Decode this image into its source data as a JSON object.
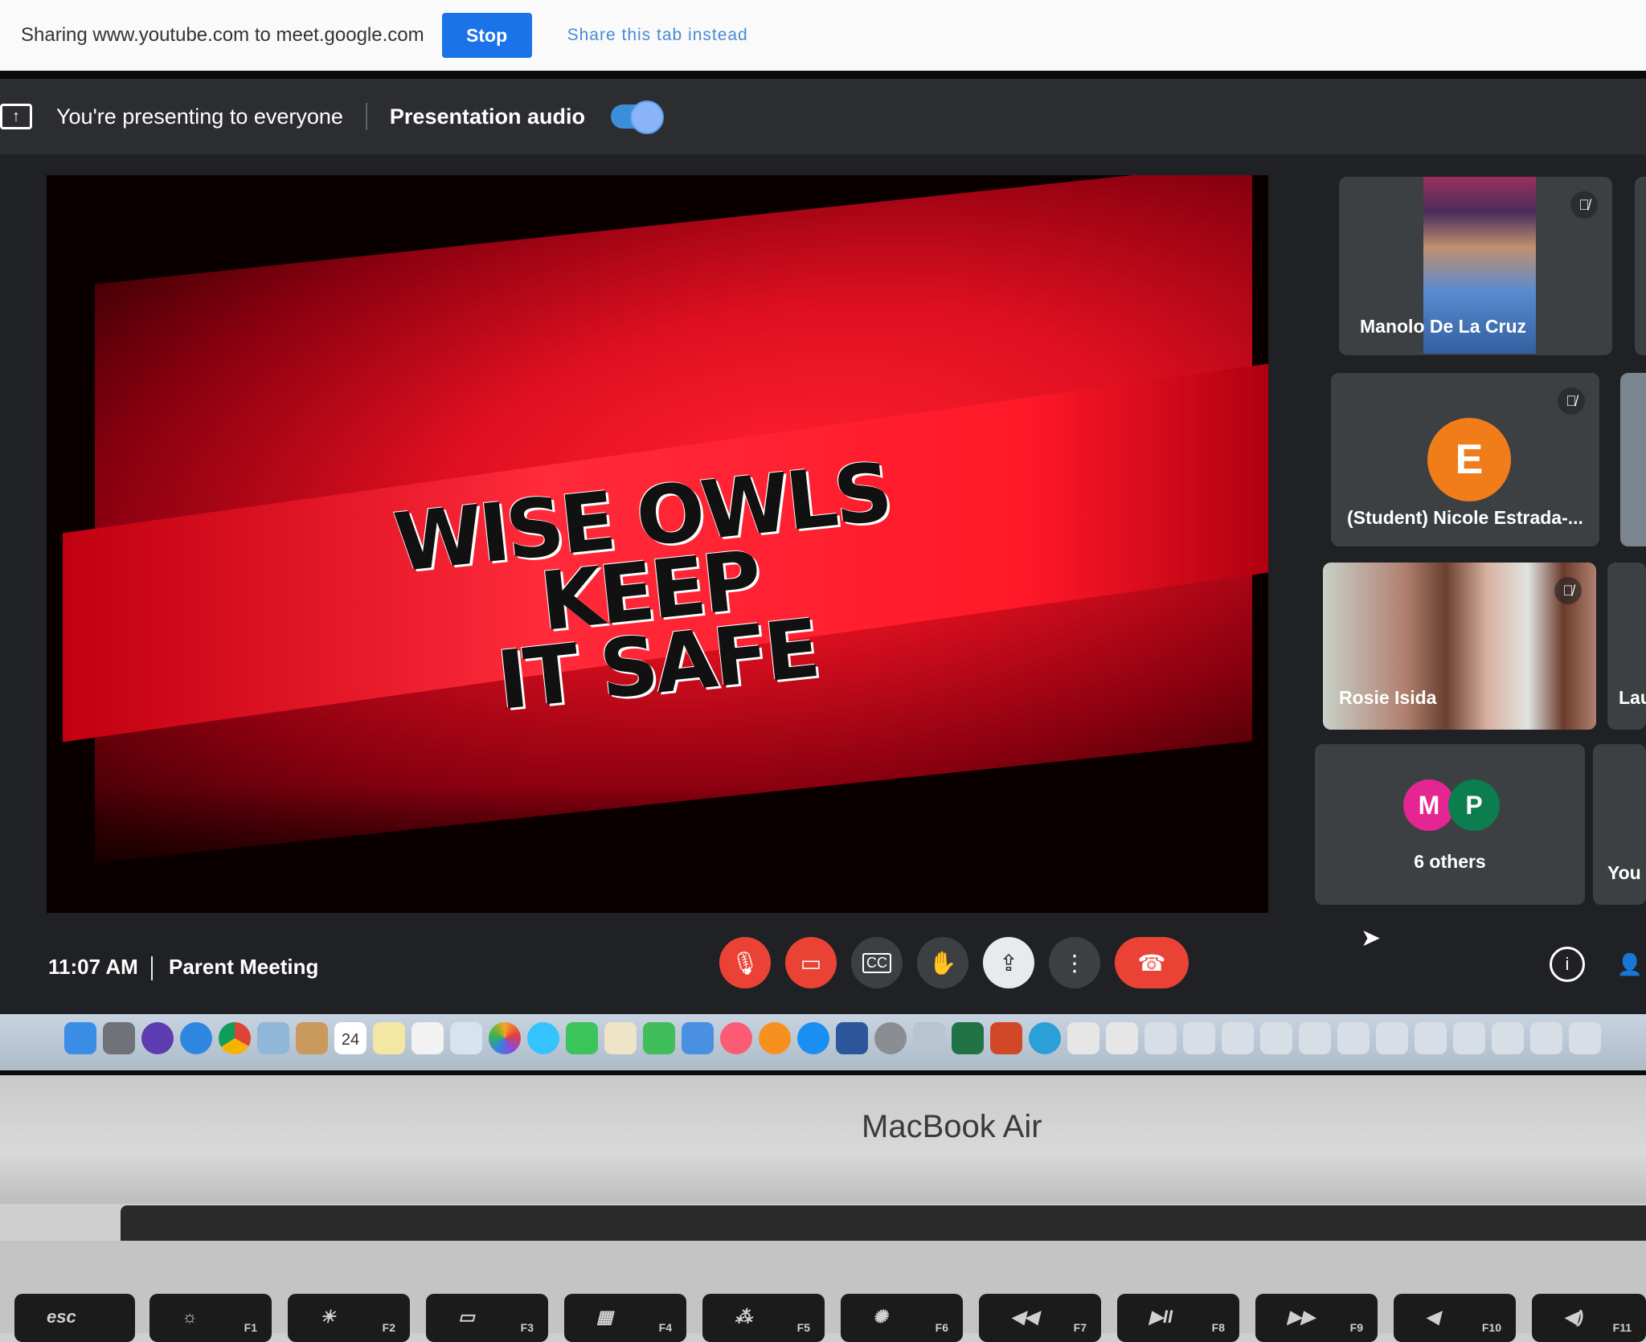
{
  "share_bar": {
    "sharing_text": "Sharing www.youtube.com to meet.google.com",
    "stop_label": "Stop",
    "share_tab_label": "Share this tab instead"
  },
  "presenting_bar": {
    "presenting_text": "You're presenting to everyone",
    "audio_label": "Presentation audio",
    "audio_enabled": true
  },
  "presentation": {
    "slogan_line1": "WISE OWLS KEEP",
    "slogan_line2": "IT SAFE"
  },
  "participants": [
    {
      "name": "Manolo De La Cruz",
      "muted": true
    },
    {
      "name": "(Student) Nicole Estrada-...",
      "avatar_letter": "E",
      "avatar_color": "#f07c1a",
      "muted": true
    },
    {
      "name": "Rosie Isida",
      "muted": true
    },
    {
      "others_label": "6 others",
      "avatars": [
        {
          "letter": "M",
          "color": "#e52592"
        },
        {
          "letter": "P",
          "color": "#0b7d4e"
        }
      ]
    }
  ],
  "side_column": {
    "partial_name": "Lau",
    "you_label": "You"
  },
  "meeting_bar": {
    "time": "11:07 AM",
    "separator": "|",
    "meeting_title": "Parent Meeting",
    "controls": [
      "mic-off",
      "camera-off",
      "captions",
      "raise-hand",
      "present",
      "more-options",
      "leave-call"
    ]
  },
  "laptop": {
    "brand": "MacBook Air",
    "keys": [
      {
        "label": "esc",
        "fn": ""
      },
      {
        "label": "",
        "fn": "F1"
      },
      {
        "label": "",
        "fn": "F2"
      },
      {
        "label": "",
        "fn": "F3"
      },
      {
        "label": "",
        "fn": "F4"
      },
      {
        "label": "",
        "fn": "F5"
      },
      {
        "label": "",
        "fn": "F6"
      },
      {
        "label": "",
        "fn": "F7"
      },
      {
        "label": "",
        "fn": "F8"
      },
      {
        "label": "",
        "fn": "F9"
      },
      {
        "label": "",
        "fn": "F10"
      },
      {
        "label": "",
        "fn": "F11"
      }
    ],
    "dock_calendar_day": "24"
  },
  "colors": {
    "meet_blue": "#1a73e8",
    "meet_red": "#ea4335",
    "meet_bg": "#202124",
    "tile_bg": "#3c4043"
  }
}
